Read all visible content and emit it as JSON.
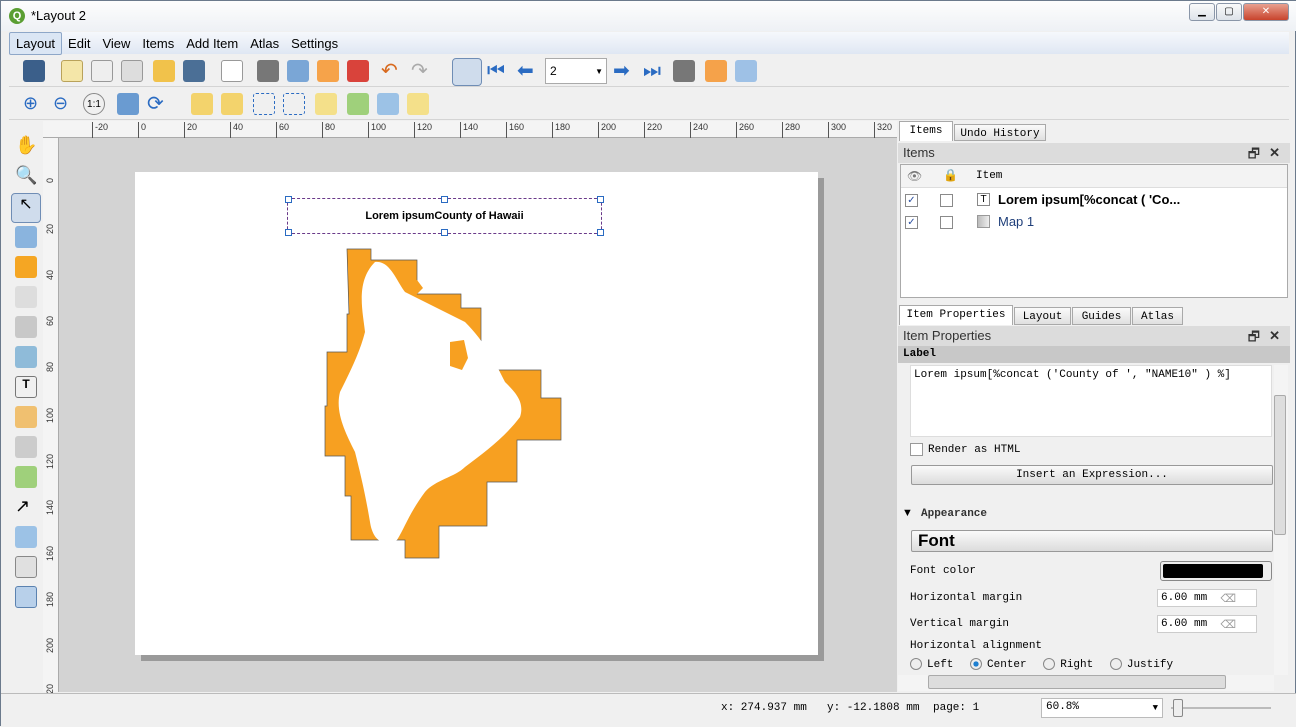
{
  "window": {
    "title": "*Layout 2"
  },
  "menu": [
    "Layout",
    "Edit",
    "View",
    "Items",
    "Add Item",
    "Atlas",
    "Settings"
  ],
  "toolbar": {
    "atlas_page": "2"
  },
  "rulers": {
    "top": [
      "-20",
      "0",
      "20",
      "40",
      "60",
      "80",
      "100",
      "120",
      "140",
      "160",
      "180",
      "200",
      "220",
      "240",
      "260",
      "280",
      "300",
      "320"
    ],
    "left": [
      "0",
      "20",
      "40",
      "60",
      "80",
      "100",
      "120",
      "140",
      "160",
      "180",
      "200",
      "20"
    ]
  },
  "canvas": {
    "label_text": "Lorem ipsumCounty of Hawaii",
    "map_fill": "#f7a021"
  },
  "items_panel": {
    "tabs": [
      "Items",
      "Undo History"
    ],
    "title": "Items",
    "column": "Item",
    "rows": [
      {
        "name": "Lorem ipsum[%concat ( 'Co...",
        "visible": true,
        "locked": false,
        "bold": true
      },
      {
        "name": "Map 1",
        "visible": true,
        "locked": false,
        "bold": false
      }
    ]
  },
  "props_panel": {
    "tabs": [
      "Item Properties",
      "Layout",
      "Guides",
      "Atlas"
    ],
    "title": "Item Properties",
    "section": "Label",
    "label_text": "Lorem ipsum[%concat ('County of ', \"NAME10\" ) %]",
    "render_html": "Render as HTML",
    "insert_expr": "Insert an Expression...",
    "appearance": "Appearance",
    "font_button": "Font",
    "font_color_label": "Font color",
    "font_color": "#000000",
    "h_margin_label": "Horizontal margin",
    "h_margin": "6.00 mm",
    "v_margin_label": "Vertical margin",
    "v_margin": "6.00 mm",
    "h_align_label": "Horizontal alignment",
    "align_options": [
      "Left",
      "Center",
      "Right",
      "Justify"
    ],
    "align_selected": "Center"
  },
  "status": {
    "x": "x: 274.937 mm",
    "y": "y: -12.1808 mm",
    "page": "page: 1",
    "zoom": "60.8%"
  }
}
